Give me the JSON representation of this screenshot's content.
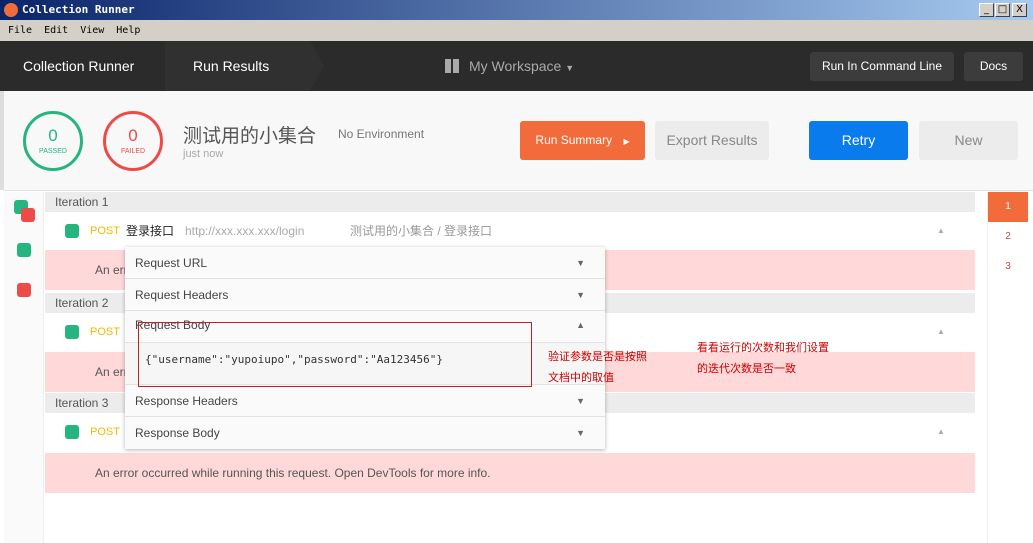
{
  "window": {
    "title": "Collection Runner",
    "controls": [
      "_",
      "□",
      "X"
    ]
  },
  "menu": [
    "File",
    "Edit",
    "View",
    "Help"
  ],
  "header": {
    "tabs": [
      "Collection Runner",
      "Run Results"
    ],
    "workspace": "My Workspace",
    "run_cli": "Run In Command Line",
    "docs": "Docs"
  },
  "summary": {
    "passed_count": "0",
    "passed_label": "PASSED",
    "failed_count": "0",
    "failed_label": "FAILED",
    "collection_name": "测试用的小集合",
    "environment": "No Environment",
    "time": "just now",
    "run_summary": "Run Summary",
    "export": "Export Results",
    "retry": "Retry",
    "new": "New"
  },
  "colors": {
    "accent": "#f26b3a",
    "retry": "#097bed",
    "pass": "#26b47f",
    "fail": "#ed4b48",
    "error_bg": "#ffd9d9"
  },
  "iterations": [
    {
      "label": "Iteration 1",
      "method": "POST",
      "name": "登录接口",
      "url": "http://xxx.xxx.xxx/login",
      "path": "测试用的小集合 / 登录接口",
      "error": "An error occurred while running this request. Open DevTools for more info."
    },
    {
      "label": "Iteration 2",
      "method": "POST",
      "error": "An error occurred while running this request. Open DevTools for more info."
    },
    {
      "label": "Iteration 3",
      "method": "POST",
      "error": "An error occurred while running this request. Open DevTools for more info."
    }
  ],
  "dropdown": {
    "request_url": "Request URL",
    "request_headers": "Request Headers",
    "request_body": "Request Body",
    "body": "{\"username\":\"yupoiupo\",\"password\":\"Aa123456\"}",
    "response_headers": "Response Headers",
    "response_body": "Response Body"
  },
  "iteration_nav": [
    "1",
    "2",
    "3"
  ],
  "annotations": {
    "a1_line1": "验证参数是否是按照",
    "a1_line2": "文档中的取值",
    "a2_line1": "看看运行的次数和我们设置",
    "a2_line2": "的迭代次数是否一致"
  }
}
